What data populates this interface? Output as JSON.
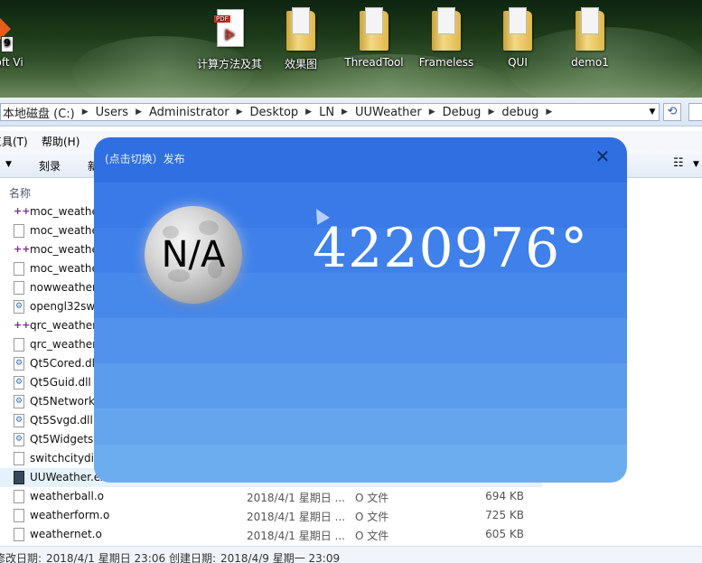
{
  "desktop": {
    "icons": [
      {
        "label": "rosoft Vi",
        "kind": "vs"
      },
      {
        "label": "计算方法及其",
        "kind": "pdf"
      },
      {
        "label": "效果图",
        "kind": "folder"
      },
      {
        "label": "ThreadTool",
        "kind": "folder"
      },
      {
        "label": "Frameless",
        "kind": "folder"
      },
      {
        "label": "QUI",
        "kind": "folder"
      },
      {
        "label": "demo1",
        "kind": "folder"
      }
    ]
  },
  "explorer": {
    "breadcrumbs": [
      "本地磁盘 (C:)",
      "Users",
      "Administrator",
      "Desktop",
      "LN",
      "UUWeather",
      "Debug",
      "debug"
    ],
    "refresh_glyph": "⟲",
    "menu": [
      "工具(T)",
      "帮助(H)"
    ],
    "toolbar": [
      "刻录",
      "新"
    ],
    "column_name": "名称",
    "files": [
      {
        "name": "moc_weathe",
        "icon": "plus",
        "date": "",
        "type": "",
        "size": ""
      },
      {
        "name": "moc_weathe",
        "icon": "file",
        "date": "",
        "type": "",
        "size": ""
      },
      {
        "name": "moc_weathe",
        "icon": "plus",
        "date": "",
        "type": "",
        "size": ""
      },
      {
        "name": "moc_weathe",
        "icon": "file",
        "date": "",
        "type": "",
        "size": ""
      },
      {
        "name": "nowweather",
        "icon": "file",
        "date": "",
        "type": "",
        "size": ""
      },
      {
        "name": "opengl32sw",
        "icon": "dll",
        "date": "",
        "type": "",
        "size": ""
      },
      {
        "name": "qrc_weather",
        "icon": "plus",
        "date": "",
        "type": "",
        "size": ""
      },
      {
        "name": "qrc_weather",
        "icon": "file",
        "date": "",
        "type": "",
        "size": ""
      },
      {
        "name": "Qt5Cored.dl",
        "icon": "dll",
        "date": "",
        "type": "",
        "size": ""
      },
      {
        "name": "Qt5Guid.dll",
        "icon": "dll",
        "date": "",
        "type": "",
        "size": ""
      },
      {
        "name": "Qt5Network",
        "icon": "dll",
        "date": "",
        "type": "",
        "size": ""
      },
      {
        "name": "Qt5Svgd.dll",
        "icon": "dll",
        "date": "",
        "type": "",
        "size": ""
      },
      {
        "name": "Qt5Widgets",
        "icon": "dll",
        "date": "",
        "type": "",
        "size": ""
      },
      {
        "name": "switchcitydia",
        "icon": "file",
        "date": "",
        "type": "",
        "size": ""
      },
      {
        "name": "UUWeather.ex",
        "icon": "exe",
        "date": "",
        "type": "",
        "size": ""
      },
      {
        "name": "weatherball.o",
        "icon": "file",
        "date": "2018/4/1 星期日 ...",
        "type": "O 文件",
        "size": "694 KB"
      },
      {
        "name": "weatherform.o",
        "icon": "file",
        "date": "2018/4/1 星期日 ...",
        "type": "O 文件",
        "size": "725 KB"
      },
      {
        "name": "weathernet.o",
        "icon": "file",
        "date": "2018/4/1 星期日 ...",
        "type": "O 文件",
        "size": "605 KB"
      }
    ],
    "status": {
      "modified_label": "修改日期:",
      "modified_value": "2018/4/1 星期日 23:06",
      "created_label": "创建日期:",
      "created_value": "2018/4/9 星期一 23:09"
    }
  },
  "weather": {
    "top_text": "(点击切换）发布",
    "close_glyph": "✕",
    "moon_label": "N/A",
    "temperature": "4220976°"
  }
}
